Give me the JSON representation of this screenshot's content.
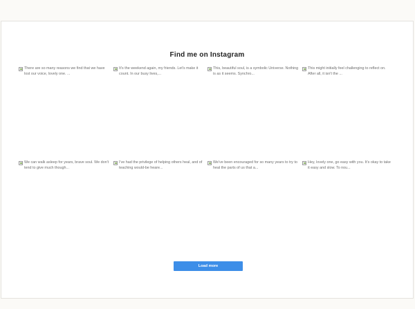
{
  "section": {
    "title": "Find me on Instagram"
  },
  "posts": [
    {
      "alt": "There are so many reasons we find that we have lost our voice, lovely one.        ..."
    },
    {
      "alt": "It's the weekend again, my friends. Let's make it count. In our busy lives,..."
    },
    {
      "alt": "This, beautiful soul, is a symbolic Universe. Nothing is as it seems. Synchro..."
    },
    {
      "alt": "This might initially feel challenging to reflect on. After all, it isn't the ..."
    },
    {
      "alt": "We can walk asleep for years, brave soul. We don't tend to give much though..."
    },
    {
      "alt": "I've had the privilege of helping others heal, and of teaching would-be heare..."
    },
    {
      "alt": "We've been encouraged for so many years to try to heal the parts of us that a..."
    },
    {
      "alt": "Hey, lovely one, go easy with you. It's okay to take it easy and slow. To nou..."
    }
  ],
  "actions": {
    "load_more_label": "Load more"
  },
  "icons": {
    "post_image": "broken-image-icon"
  },
  "colors": {
    "accent": "#3d8ee8"
  }
}
